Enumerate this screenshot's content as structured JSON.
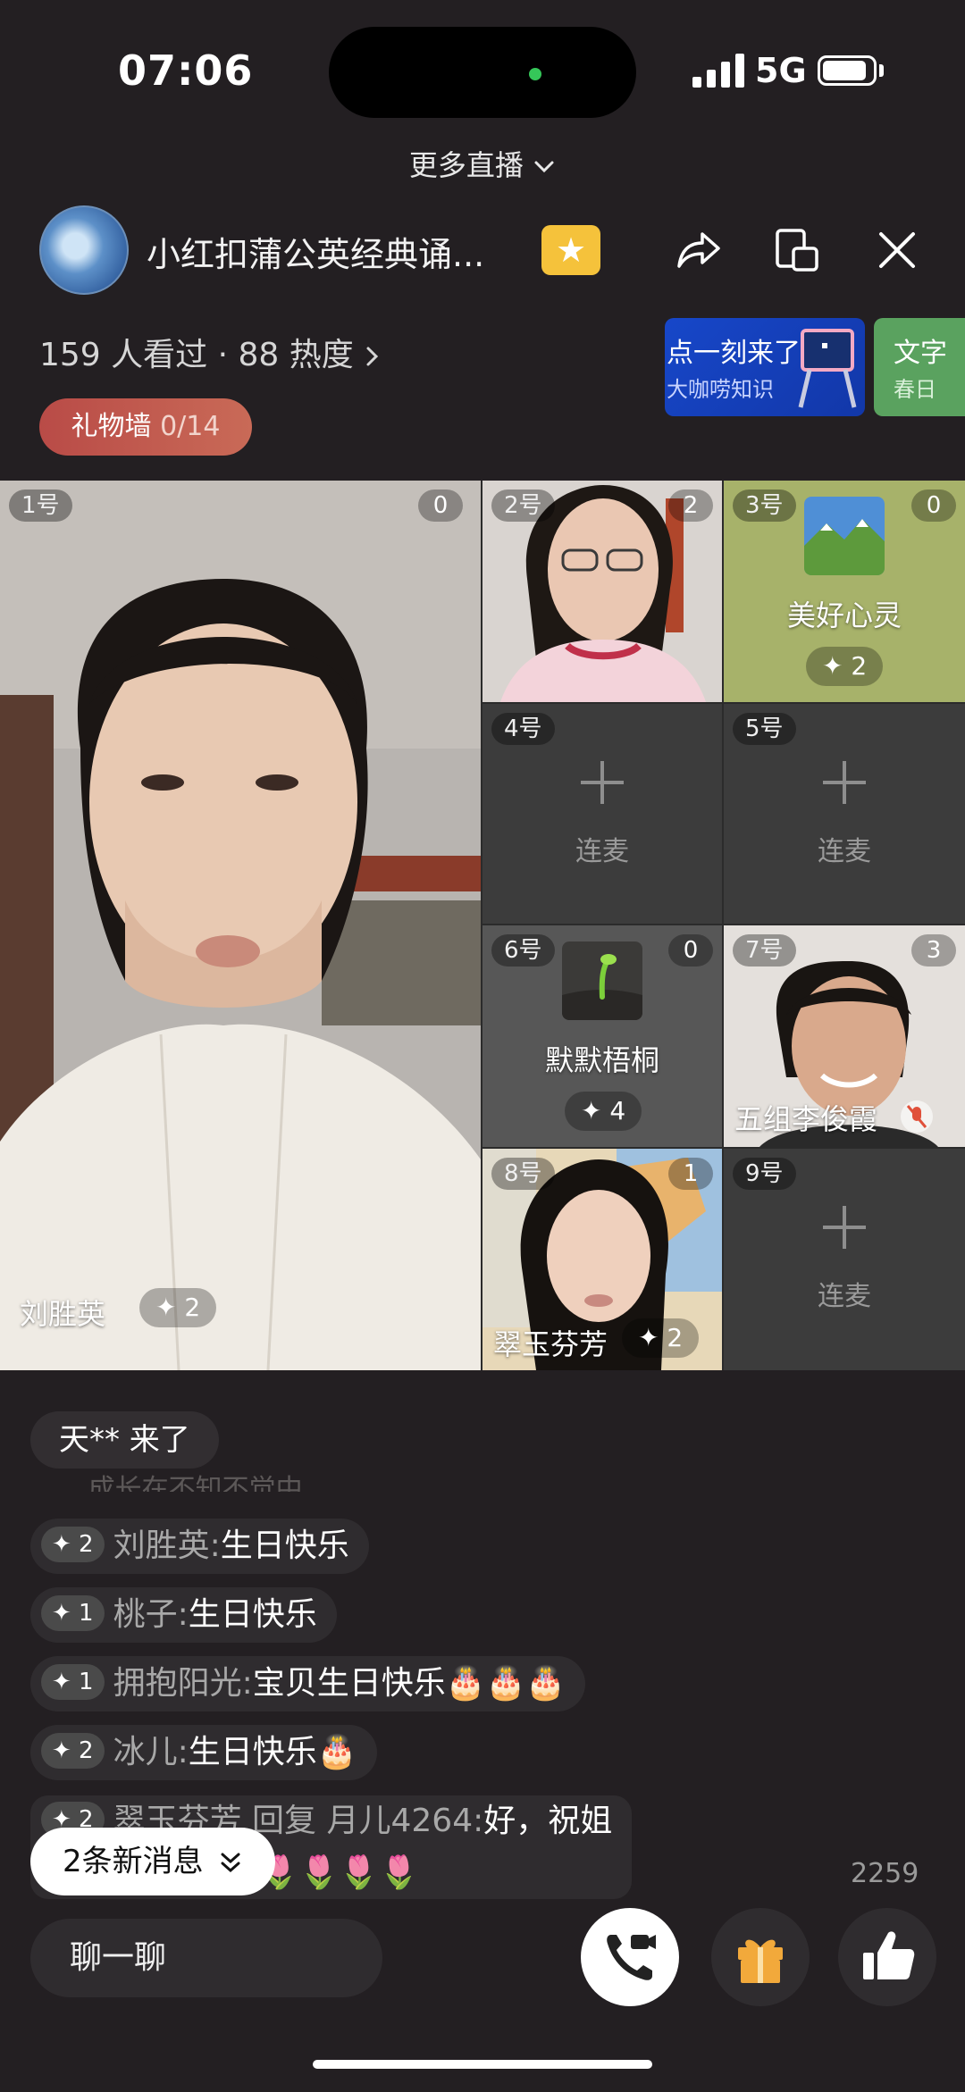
{
  "status_bar": {
    "time": "07:06",
    "network": "5G"
  },
  "more_live": "更多直播",
  "room": {
    "title": "小红扣蒲公英经典诵...",
    "viewers": "159 人看过 · 88 热度",
    "gift_wall_label": "礼物墙",
    "gift_wall_count": "0/14"
  },
  "promos": [
    {
      "title": "点一刻来了",
      "subtitle": "大咖唠知识"
    },
    {
      "title": "文字",
      "subtitle": "春日"
    }
  ],
  "seats": [
    {
      "num": "1号",
      "count": "0",
      "name": "刘胜英",
      "spark": "✦ 2"
    },
    {
      "num": "2号",
      "count": "2"
    },
    {
      "num": "3号",
      "count": "0",
      "name": "美好心灵",
      "spark": "✦ 2"
    },
    {
      "num": "4号",
      "action": "连麦"
    },
    {
      "num": "5号",
      "action": "连麦"
    },
    {
      "num": "6号",
      "count": "0",
      "name": "默默梧桐",
      "spark": "✦ 4"
    },
    {
      "num": "7号",
      "count": "3",
      "name": "五组李俊霞"
    },
    {
      "num": "8号",
      "count": "1",
      "name": "翠玉芬芳",
      "spark": "✦ 2"
    },
    {
      "num": "9号",
      "action": "连麦"
    }
  ],
  "chat": {
    "join": "天** 来了",
    "faded": "...成长在不知不觉中",
    "messages": [
      {
        "level": "✦ 2",
        "user": "刘胜英",
        "text": "生日快乐"
      },
      {
        "level": "✦ 1",
        "user": "桃子",
        "text": "生日快乐"
      },
      {
        "level": "✦ 1",
        "user": "拥抱阳光",
        "text": "宝贝生日快乐🎂🎂🎂"
      },
      {
        "level": "✦ 2",
        "user": "冰儿",
        "text": "生日快乐🎂"
      },
      {
        "level": "✦ 2",
        "user": "翠玉芬芳 回复 月儿4264",
        "text": "好，祝姐",
        "line2": "一切如意🌷🌷🌷🌷🌷🌷"
      }
    ],
    "new_messages": "2条新消息",
    "count": "2259"
  },
  "bottom_bar": {
    "chat_placeholder": "聊一聊"
  }
}
